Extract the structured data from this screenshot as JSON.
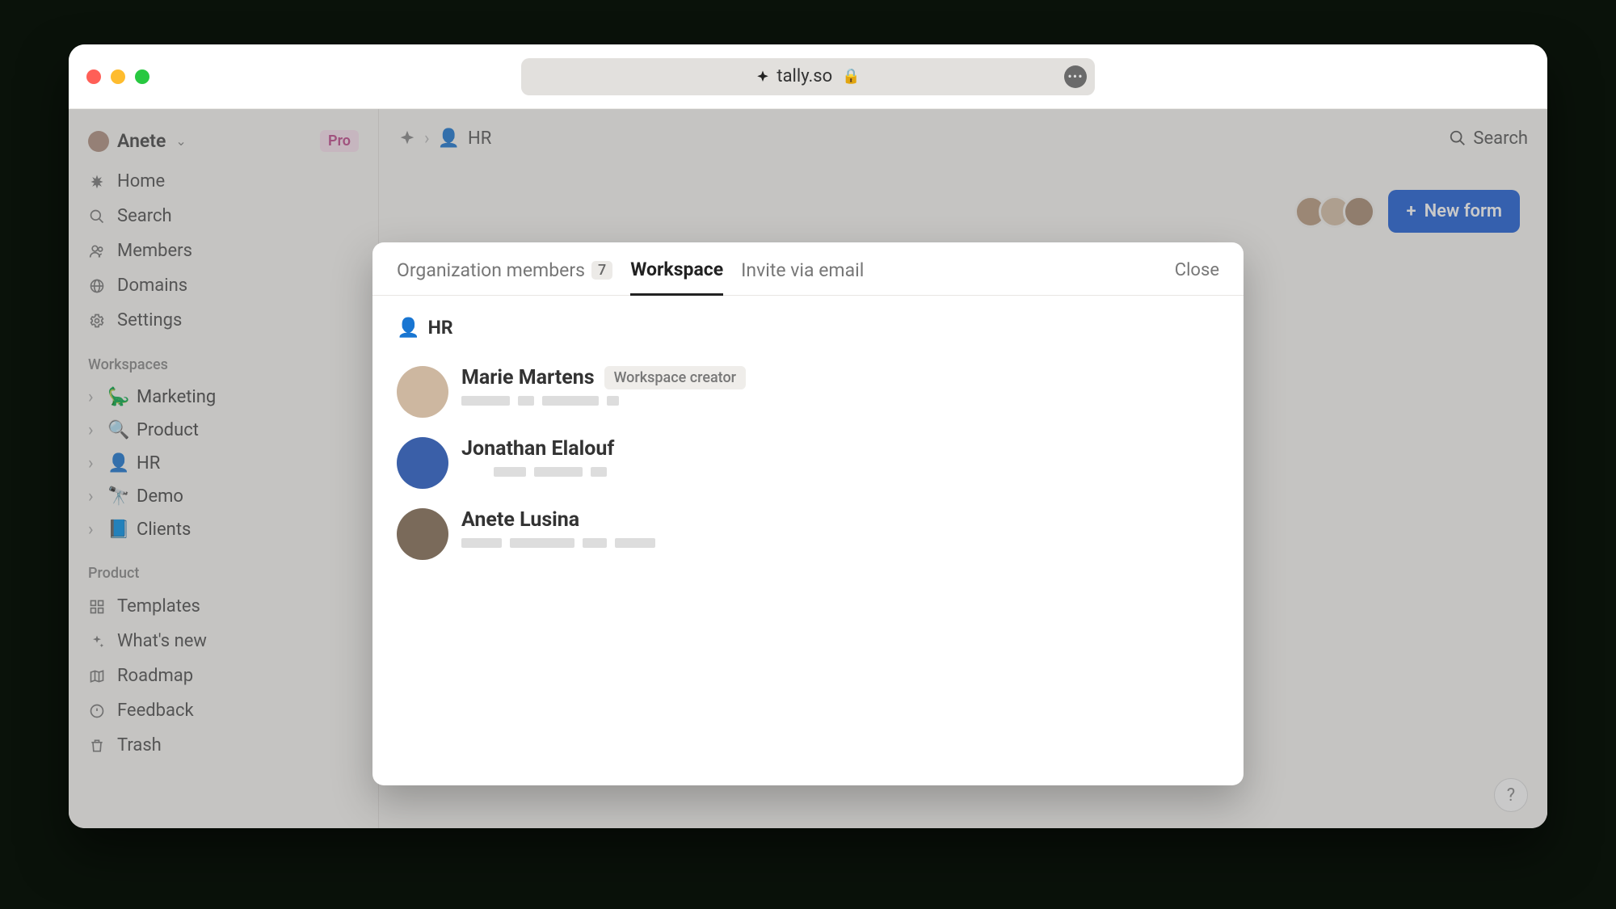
{
  "browser": {
    "url": "tally.so"
  },
  "account": {
    "name": "Anete",
    "badge": "Pro"
  },
  "nav": {
    "home": "Home",
    "search": "Search",
    "members": "Members",
    "domains": "Domains",
    "settings": "Settings"
  },
  "workspacesHeader": "Workspaces",
  "workspaces": [
    {
      "emoji": "🦕",
      "label": "Marketing"
    },
    {
      "emoji": "🔍",
      "label": "Product"
    },
    {
      "emoji": "👤",
      "label": "HR"
    },
    {
      "emoji": "🔭",
      "label": "Demo"
    },
    {
      "emoji": "📘",
      "label": "Clients"
    }
  ],
  "productHeader": "Product",
  "product": {
    "templates": "Templates",
    "whatsnew": "What's new",
    "roadmap": "Roadmap",
    "feedback": "Feedback",
    "trash": "Trash"
  },
  "breadcrumb": {
    "icon": "👤",
    "label": "HR"
  },
  "topSearch": "Search",
  "newFormLabel": "New form",
  "modal": {
    "tabs": {
      "org": "Organization members",
      "orgCount": "7",
      "workspace": "Workspace",
      "invite": "Invite via email"
    },
    "close": "Close",
    "workspaceIcon": "👤",
    "workspaceName": "HR",
    "creatorBadge": "Workspace creator",
    "members": [
      {
        "name": "Marie Martens",
        "creator": true
      },
      {
        "name": "Jonathan Elalouf",
        "creator": false
      },
      {
        "name": "Anete Lusina",
        "creator": false
      }
    ]
  },
  "colors": {
    "ava1": "#b89a7f",
    "ava2": "#d6bfa6",
    "ava3": "#a88a72",
    "m1": "#cdb7a0",
    "m2": "#3a5fa8",
    "m3": "#7a6a5a"
  }
}
